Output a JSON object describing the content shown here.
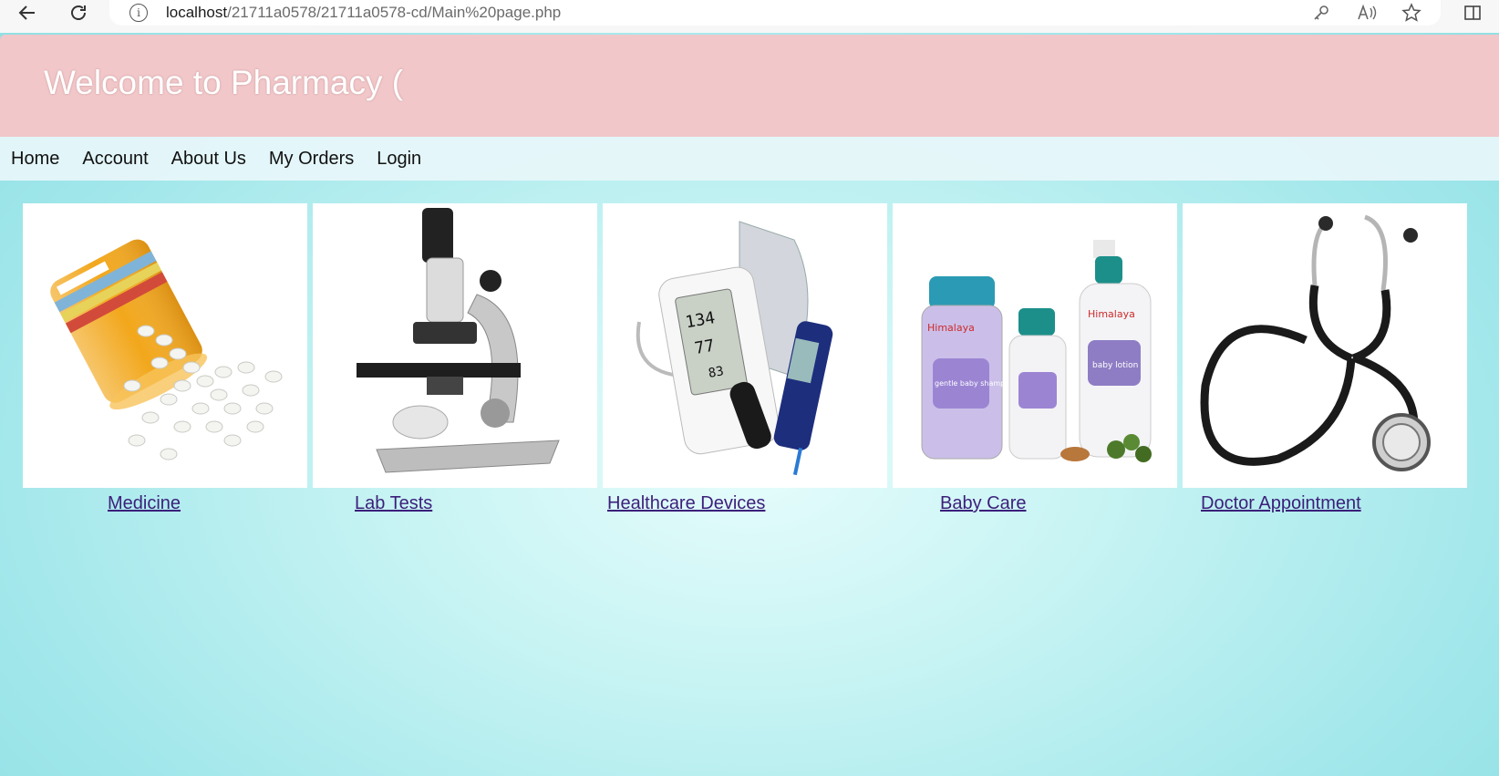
{
  "browser": {
    "url_host": "localhost",
    "url_path": "/21711a0578/21711a0578-cd/Main%20page.php"
  },
  "banner": {
    "title": "Welcome to Pharmacy ("
  },
  "nav": {
    "items": [
      {
        "label": "Home"
      },
      {
        "label": "Account"
      },
      {
        "label": "About Us"
      },
      {
        "label": "My Orders"
      },
      {
        "label": "Login"
      }
    ]
  },
  "products": [
    {
      "label": "Medicine",
      "image": "pill-bottle-image"
    },
    {
      "label": "Lab Tests",
      "image": "microscope-image"
    },
    {
      "label": "Healthcare Devices",
      "image": "bp-monitor-image"
    },
    {
      "label": "Baby Care",
      "image": "baby-products-image"
    },
    {
      "label": "Doctor Appointment",
      "image": "stethoscope-image"
    }
  ],
  "images_text": {
    "bp_sys": "134",
    "bp_dia": "77",
    "bp_pulse": "83",
    "brand": "Himalaya",
    "shampoo": "gentle baby shampoo",
    "lotion": "baby lotion"
  }
}
